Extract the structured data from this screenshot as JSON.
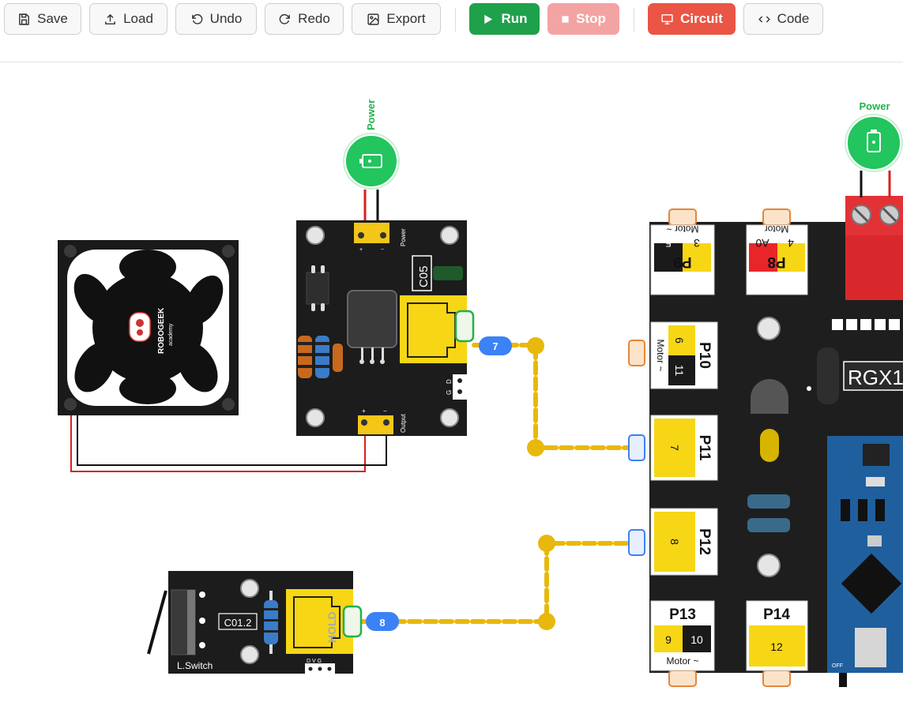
{
  "toolbar": {
    "save": "Save",
    "load": "Load",
    "undo": "Undo",
    "redo": "Redo",
    "export": "Export",
    "run": "Run",
    "stop": "Stop",
    "circuit": "Circuit",
    "code": "Code"
  },
  "colors": {
    "run": "#1fa04b",
    "stop": "#f4a3a3",
    "circuit": "#ea5545",
    "wire": "#e8b80c",
    "pin_badge": "#3b82f6",
    "power": "#22c55e"
  },
  "canvas": {
    "power_label": "Power",
    "power_label_right": "Power",
    "fan": {
      "brand": "ROBOGEEK",
      "sub": "academy"
    },
    "relay": {
      "code": "C05",
      "power_pin": "Power",
      "output_pin": "Output",
      "plus": "+",
      "minus": "−",
      "g": "G",
      "d": "D"
    },
    "switch": {
      "code": "C01.2",
      "name": "L.Switch",
      "hold": "HOLD",
      "pins": "D V G"
    },
    "badges": {
      "relay_pin": "7",
      "switch_pin": "8"
    },
    "board": {
      "label": "RGX1",
      "off": "OFF",
      "p9": {
        "name": "P9",
        "a": "5",
        "b": "3",
        "motor": "Motor ~"
      },
      "p8": {
        "name": "P8",
        "a": "A0",
        "b": "4",
        "motor": "Motor"
      },
      "p10": {
        "name": "P10",
        "a": "6",
        "b": "11",
        "motor": "Motor ~"
      },
      "p11": {
        "name": "P11",
        "a": "7"
      },
      "p12": {
        "name": "P12",
        "a": "8"
      },
      "p13": {
        "name": "P13",
        "a": "9",
        "b": "10",
        "motor": "Motor ~"
      },
      "p14": {
        "name": "P14",
        "a": "12"
      }
    }
  }
}
